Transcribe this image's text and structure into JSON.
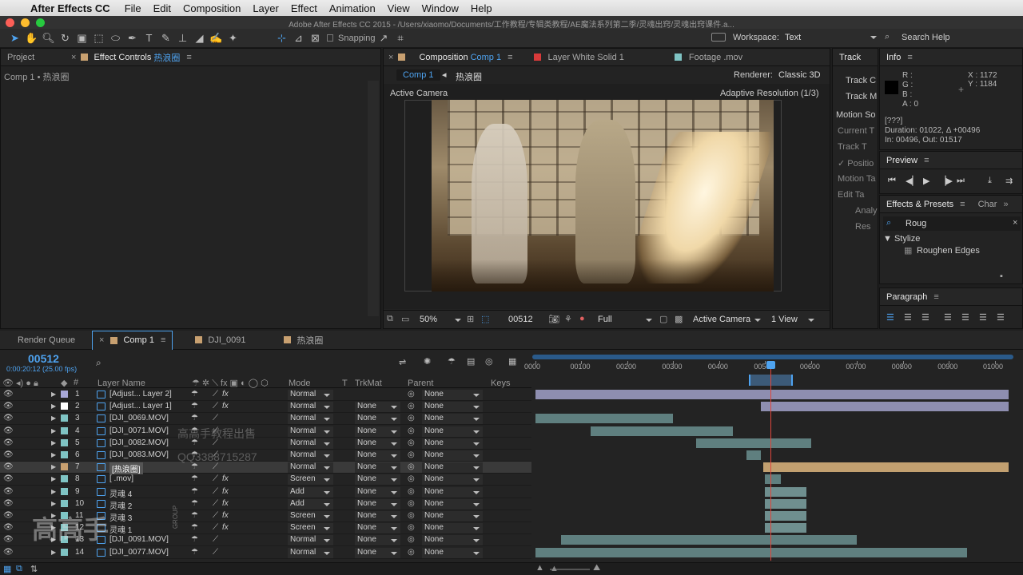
{
  "menubar": {
    "app": "After Effects CC",
    "items": [
      "File",
      "Edit",
      "Composition",
      "Layer",
      "Effect",
      "Animation",
      "View",
      "Window",
      "Help"
    ]
  },
  "window_title": "Adobe After Effects CC 2015 - /Users/xiaomo/Documents/工作教程/专辑类教程/AE魔法系列第二季/灵魂出窍/灵魂出窍课件.a...",
  "toolbar": {
    "snapping": "Snapping",
    "workspace_label": "Workspace:",
    "workspace_value": "Text",
    "search_help": "Search Help"
  },
  "project_panel": {
    "tab_project": "Project",
    "tab_effect_controls": "Effect Controls",
    "effect_controls_target": "热浪圈",
    "breadcrumb": "Comp 1 • 热浪圈"
  },
  "viewer": {
    "tab_composition": "Composition",
    "tab_comp_name": "Comp 1",
    "tab_layer": "Layer White Solid 1",
    "tab_footage": "Footage .mov",
    "comp_button": "Comp 1",
    "layer_crumb": "热浪圈",
    "renderer_label": "Renderer:",
    "renderer_value": "Classic 3D",
    "active_camera": "Active Camera",
    "adaptive_res": "Adaptive Resolution (1/3)",
    "zoom": "50%",
    "timecode": "00512",
    "resolution": "Full",
    "camera_select": "Active Camera",
    "views": "1 View"
  },
  "tracker": {
    "tab": "Track",
    "items": [
      "Track C",
      "Track M",
      "Motion So",
      "Current T",
      "Track T",
      "✓ Positio",
      "Motion Ta",
      "Edit Ta",
      "Analy",
      "Res"
    ]
  },
  "info": {
    "tab": "Info",
    "r": "R :",
    "g": "G :",
    "b": "B :",
    "a": "A : 0",
    "x": "X : 1172",
    "y": "Y : 1184",
    "line1": "[???]",
    "line2": "Duration: 01022, Δ +00496",
    "line3": "In: 00496, Out: 01517"
  },
  "preview": {
    "tab": "Preview"
  },
  "effects": {
    "tab": "Effects & Presets",
    "tab2": "Char",
    "search": "Roug",
    "category": "▼ Stylize",
    "effect": "Roughen Edges"
  },
  "paragraph": {
    "tab": "Paragraph"
  },
  "timeline_tabs": {
    "render_queue": "Render Queue",
    "comp1": "Comp 1",
    "dji": "DJI_0091",
    "heat": "热浪圈"
  },
  "timeline": {
    "timecode": "00512",
    "sub_timecode": "0:00:20:12 (25.00 fps)",
    "col_layer_name": "Layer Name",
    "col_mode": "Mode",
    "col_t": "T",
    "col_trkmat": "TrkMat",
    "col_parent": "Parent",
    "col_keys": "Keys",
    "ruler": [
      "0000",
      "00100",
      "00200",
      "00300",
      "00400",
      "00500",
      "00600",
      "00700",
      "00800",
      "00900",
      "01000"
    ],
    "cti_frame": 512,
    "total_frames": 1030,
    "layers": [
      {
        "num": "1",
        "name": "[Adjust... Layer 2]",
        "color": "#a8a8d8",
        "mode": "Normal",
        "trkmat": "",
        "parent": "None",
        "fx": "fx",
        "bar_in": 0,
        "bar_out": 1030,
        "bar_color": "#8e8eb0"
      },
      {
        "num": "2",
        "name": "[Adjust... Layer 1]",
        "color": "#ffffff",
        "mode": "Normal",
        "trkmat": "None",
        "parent": "None",
        "fx": "fx",
        "bar_in": 490,
        "bar_out": 1030,
        "bar_color": "#8e8eb0"
      },
      {
        "num": "3",
        "name": "[DJI_0069.MOV]",
        "color": "#7fc4c4",
        "mode": "Normal",
        "trkmat": "None",
        "parent": "None",
        "fx": "",
        "bar_in": 0,
        "bar_out": 300,
        "bar_color": "#5f7f7f"
      },
      {
        "num": "4",
        "name": "[DJI_0071.MOV]",
        "color": "#7fc4c4",
        "mode": "Normal",
        "trkmat": "None",
        "parent": "None",
        "fx": "",
        "bar_in": 120,
        "bar_out": 430,
        "bar_color": "#5f7f7f"
      },
      {
        "num": "5",
        "name": "[DJI_0082.MOV]",
        "color": "#7fc4c4",
        "mode": "Normal",
        "trkmat": "None",
        "parent": "None",
        "fx": "",
        "bar_in": 350,
        "bar_out": 600,
        "bar_color": "#5f7f7f"
      },
      {
        "num": "6",
        "name": "[DJI_0083.MOV]",
        "color": "#7fc4c4",
        "mode": "Normal",
        "trkmat": "None",
        "parent": "None",
        "fx": "",
        "bar_in": 460,
        "bar_out": 490,
        "bar_color": "#5f7f7f"
      },
      {
        "num": "7",
        "name": "[热浪圈]",
        "color": "#c8a070",
        "mode": "Normal",
        "trkmat": "None",
        "parent": "None",
        "fx": "",
        "bar_in": 496,
        "bar_out": 1030,
        "bar_color": "#c2a070",
        "selected": true
      },
      {
        "num": "8",
        "name": "[ .mov]",
        "color": "#7fc4c4",
        "mode": "Screen",
        "trkmat": "None",
        "parent": "None",
        "fx": "fx",
        "bar_in": 500,
        "bar_out": 535,
        "bar_color": "#5f7f7f"
      },
      {
        "num": "9",
        "name": "灵魂 4",
        "color": "#7fc4c4",
        "mode": "Add",
        "trkmat": "None",
        "parent": "None",
        "fx": "fx",
        "bar_in": 500,
        "bar_out": 590,
        "bar_color": "#6f8f8f"
      },
      {
        "num": "10",
        "name": "灵魂 2",
        "color": "#7fc4c4",
        "mode": "Add",
        "trkmat": "None",
        "parent": "None",
        "fx": "fx",
        "bar_in": 500,
        "bar_out": 590,
        "bar_color": "#6f8f8f"
      },
      {
        "num": "11",
        "name": "灵魂 3",
        "color": "#7fc4c4",
        "mode": "Screen",
        "trkmat": "None",
        "parent": "None",
        "fx": "fx",
        "bar_in": 500,
        "bar_out": 590,
        "bar_color": "#6f8f8f"
      },
      {
        "num": "12",
        "name": "灵魂 1",
        "color": "#7fc4c4",
        "mode": "Screen",
        "trkmat": "None",
        "parent": "None",
        "fx": "fx",
        "bar_in": 500,
        "bar_out": 590,
        "bar_color": "#6f8f8f"
      },
      {
        "num": "13",
        "name": "[DJI_0091.MOV]",
        "color": "#7fc4c4",
        "mode": "Normal",
        "trkmat": "None",
        "parent": "None",
        "fx": "",
        "bar_in": 55,
        "bar_out": 700,
        "bar_color": "#5f7f7f"
      },
      {
        "num": "14",
        "name": "[DJI_0077.MOV]",
        "color": "#7fc4c4",
        "mode": "Normal",
        "trkmat": "None",
        "parent": "None",
        "fx": "",
        "bar_in": 0,
        "bar_out": 940,
        "bar_color": "#5f7f7f"
      }
    ]
  },
  "watermark": {
    "text1": "高高手教程出售",
    "text2": "QQ3388715287",
    "logo": "高高手",
    "logo_sub": "GROUP"
  },
  "colors": {
    "accent": "#4ea3f0",
    "cti": "#e0463c",
    "panel": "#232323"
  }
}
